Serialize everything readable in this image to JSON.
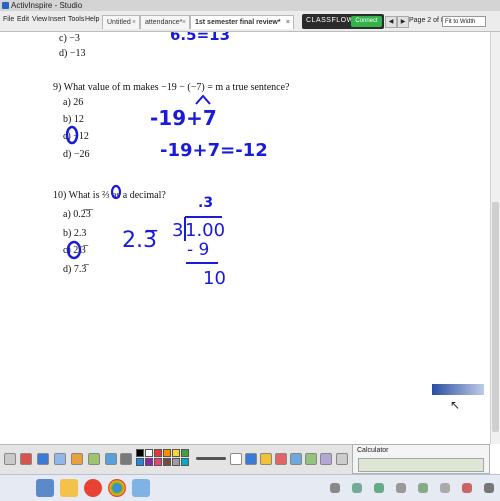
{
  "window": {
    "title": "ActivInspire - Studio"
  },
  "menu": [
    "File",
    "Edit",
    "View",
    "Insert",
    "Tools",
    "Help"
  ],
  "tabs": [
    {
      "label": "Untitled"
    },
    {
      "label": "attendance*"
    },
    {
      "label": "1st semester final review*"
    }
  ],
  "classflow": {
    "brand": "CLASSFLOW",
    "connect": "Connect"
  },
  "page_info": "Page 2 of 8",
  "zoom": "Fit to Width",
  "questions": {
    "prev": {
      "c": "c)  −3",
      "d": "d)  −13"
    },
    "q9": {
      "prompt": "9)  What value of m makes −19 − (−7) = m a true sentence?",
      "a": "a)  26",
      "b": "b)  12",
      "c": "c)  −12",
      "d": "d)  −26"
    },
    "q10": {
      "prompt": "10)  What is   ⅔   as a decimal?",
      "a": "a)  0.2̅3̅",
      "b": "b)  2.3",
      "c": "c)  2.3̅",
      "d": "d)  7.3̅"
    }
  },
  "handwriting": {
    "top": "6.5=13",
    "q9_line1": "-19+7",
    "q9_line2": "-19+7=-12",
    "q10_answer": "2.3̅",
    "q10_quotient": ".3",
    "q10_divisor": "3",
    "q10_dividend": "1.00",
    "q10_sub": "- 9",
    "q10_rem": "10"
  },
  "calculator": {
    "title": "Calculator"
  },
  "colors": {
    "ink": "#1a1ad9",
    "accent": "#35b34a",
    "toolbar": "#e4e4e4"
  }
}
